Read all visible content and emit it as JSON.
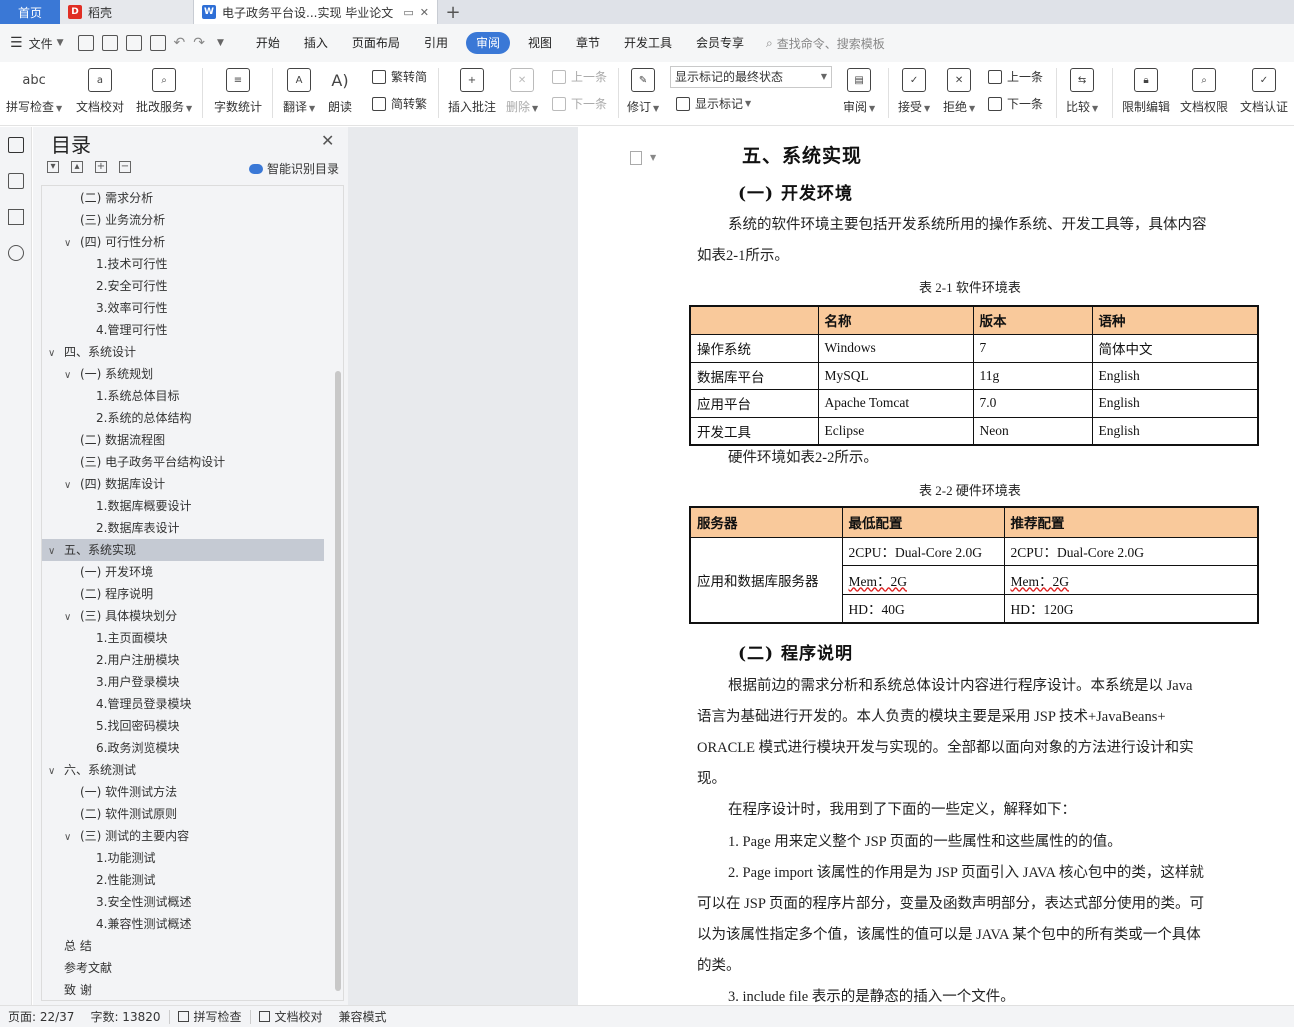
{
  "tabs": {
    "home": "首页",
    "tab1": "稻壳",
    "tab2": "电子政务平台设...实现 毕业论文",
    "add": "+"
  },
  "menubar": {
    "file": "文件",
    "tabs": [
      "开始",
      "插入",
      "页面布局",
      "引用",
      "审阅",
      "视图",
      "章节",
      "开发工具",
      "会员专享"
    ],
    "active": "审阅",
    "search": "查找命令、搜索模板"
  },
  "ribbon": {
    "spell": "拼写检查",
    "proof": "文档校对",
    "review_service": "批改服务",
    "wordcount": "字数统计",
    "translate": "翻译",
    "read": "朗读",
    "trad": "繁转简",
    "simp": "简转繁",
    "insert_comment": "插入批注",
    "delete": "删除",
    "prev": "上一条",
    "next": "下一条",
    "revise": "修订",
    "show_state": "显示标记的最终状态",
    "show_marks": "显示标记",
    "review": "审阅",
    "accept": "接受",
    "reject": "拒绝",
    "prev2": "上一条",
    "next2": "下一条",
    "compare": "比较",
    "restrict": "限制编辑",
    "perm": "文档权限",
    "auth": "文档认证"
  },
  "toc": {
    "title": "目录",
    "smart": "智能识别目录",
    "items": [
      {
        "text": "(二) 需求分析",
        "level": 2,
        "chev": ""
      },
      {
        "text": "(三) 业务流分析",
        "level": 2,
        "chev": ""
      },
      {
        "text": "(四) 可行性分析",
        "level": 2,
        "chev": "v"
      },
      {
        "text": "1.技术可行性",
        "level": 3,
        "chev": ""
      },
      {
        "text": "2.安全可行性",
        "level": 3,
        "chev": ""
      },
      {
        "text": "3.效率可行性",
        "level": 3,
        "chev": ""
      },
      {
        "text": "4.管理可行性",
        "level": 3,
        "chev": ""
      },
      {
        "text": "四、系统设计",
        "level": 1,
        "chev": "v"
      },
      {
        "text": "(一) 系统规划",
        "level": 2,
        "chev": "v"
      },
      {
        "text": "1.系统总体目标",
        "level": 3,
        "chev": ""
      },
      {
        "text": "2.系统的总体结构",
        "level": 3,
        "chev": ""
      },
      {
        "text": "(二) 数据流程图",
        "level": 2,
        "chev": ""
      },
      {
        "text": "(三) 电子政务平台结构设计",
        "level": 2,
        "chev": ""
      },
      {
        "text": "(四) 数据库设计",
        "level": 2,
        "chev": "v"
      },
      {
        "text": "1.数据库概要设计",
        "level": 3,
        "chev": ""
      },
      {
        "text": "2.数据库表设计",
        "level": 3,
        "chev": ""
      },
      {
        "text": "五、系统实现",
        "level": 1,
        "chev": "v",
        "selected": true
      },
      {
        "text": "(一) 开发环境",
        "level": 2,
        "chev": ""
      },
      {
        "text": "(二) 程序说明",
        "level": 2,
        "chev": ""
      },
      {
        "text": "(三) 具体模块划分",
        "level": 2,
        "chev": "v"
      },
      {
        "text": "1.主页面模块",
        "level": 3,
        "chev": ""
      },
      {
        "text": "2.用户注册模块",
        "level": 3,
        "chev": ""
      },
      {
        "text": "3.用户登录模块",
        "level": 3,
        "chev": ""
      },
      {
        "text": "4.管理员登录模块",
        "level": 3,
        "chev": ""
      },
      {
        "text": "5.找回密码模块",
        "level": 3,
        "chev": ""
      },
      {
        "text": "6.政务浏览模块",
        "level": 3,
        "chev": ""
      },
      {
        "text": "六、系统测试",
        "level": 1,
        "chev": "v"
      },
      {
        "text": "(一) 软件测试方法",
        "level": 2,
        "chev": ""
      },
      {
        "text": "(二) 软件测试原则",
        "level": 2,
        "chev": ""
      },
      {
        "text": "(三) 测试的主要内容",
        "level": 2,
        "chev": "v"
      },
      {
        "text": "1.功能测试",
        "level": 3,
        "chev": ""
      },
      {
        "text": "2.性能测试",
        "level": 3,
        "chev": ""
      },
      {
        "text": "3.安全性测试概述",
        "level": 3,
        "chev": ""
      },
      {
        "text": "4.兼容性测试概述",
        "level": 3,
        "chev": ""
      },
      {
        "text": "总  结",
        "level": 1,
        "chev": ""
      },
      {
        "text": "参考文献",
        "level": 1,
        "chev": ""
      },
      {
        "text": "致  谢",
        "level": 1,
        "chev": ""
      }
    ]
  },
  "doc": {
    "h1": "五、系统实现",
    "h2a": "(一) 开发环境",
    "p1a": "系统的软件环境主要包括开发系统所用的操作系统、开发工具等，具体内容",
    "p1b": "如表2-1所示。",
    "cap1": "表 2-1 软件环境表",
    "t1": {
      "header": [
        "",
        "名称",
        "版本",
        "语种"
      ],
      "rows": [
        [
          "操作系统",
          "Windows",
          "7",
          "简体中文"
        ],
        [
          "数据库平台",
          "MySQL",
          "11g",
          "English"
        ],
        [
          "应用平台",
          "Apache Tomcat",
          "7.0",
          "English"
        ],
        [
          "开发工具",
          "Eclipse",
          "Neon",
          "English"
        ]
      ]
    },
    "p2": "硬件环境如表2-2所示。",
    "cap2": "表 2-2 硬件环境表",
    "t2": {
      "header": [
        "服务器",
        "最低配置",
        "推荐配置"
      ],
      "server": "应用和数据库服务器",
      "rows": [
        [
          "2CPU：Dual-Core 2.0G",
          "2CPU：Dual-Core 2.0G"
        ],
        [
          "Mem：2G",
          "Mem：2G"
        ],
        [
          "HD：40G",
          "HD：120G"
        ]
      ]
    },
    "h2b": "(二) 程序说明",
    "p3": [
      "根据前边的需求分析和系统总体设计内容进行程序设计。本系统是以 Java",
      "语言为基础进行开发的。本人负责的模块主要是采用 JSP 技术+JavaBeans+",
      "ORACLE 模式进行模块开发与实现的。全部都以面向对象的方法进行设计和实",
      "现。"
    ],
    "p4": "在程序设计时，我用到了下面的一些定义，解释如下：",
    "p5": "1. Page 用来定义整个 JSP 页面的一些属性和这些属性的的值。",
    "p6": [
      "2. Page import 该属性的作用是为 JSP 页面引入 JAVA 核心包中的类，这样就",
      "可以在 JSP 页面的程序片部分，变量及函数声明部分，表达式部分使用的类。可",
      "以为该属性指定多个值，该属性的值可以是 JAVA 某个包中的所有类或一个具体",
      "的类。"
    ],
    "p7": "3. include file  表示的是静态的插入一个文件。"
  },
  "status": {
    "page": "页面: 22/37",
    "words": "字数: 13820",
    "spell": "拼写检查",
    "proof": "文档校对",
    "compat": "兼容模式"
  },
  "colors": {
    "accent": "#3a78d6",
    "table_header": "#f9c99b",
    "selected": "#c5cad3"
  }
}
